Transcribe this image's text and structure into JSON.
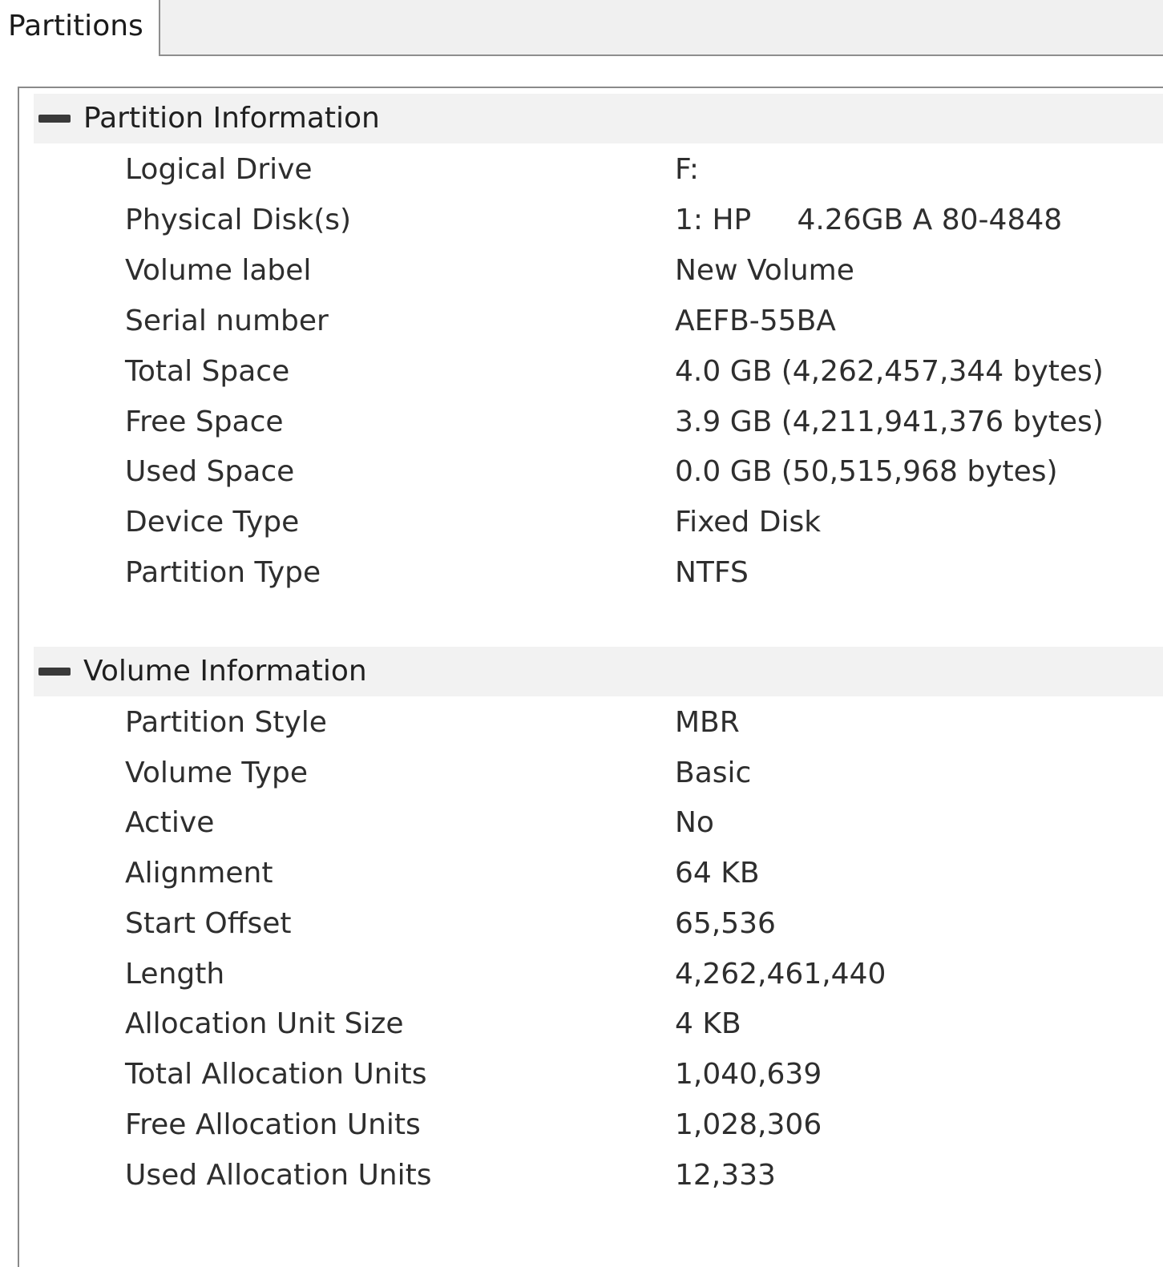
{
  "tab": {
    "label": "Partitions"
  },
  "partition_info": {
    "title": "Partition Information",
    "rows": [
      {
        "label": "Logical Drive",
        "value": "F:"
      },
      {
        "label": "Physical Disk(s)",
        "value": "1: HP     4.26GB A 80-4848"
      },
      {
        "label": "Volume label",
        "value": "New Volume"
      },
      {
        "label": "Serial number",
        "value": "AEFB-55BA"
      },
      {
        "label": "Total Space",
        "value": "4.0 GB (4,262,457,344 bytes)"
      },
      {
        "label": "Free Space",
        "value": "3.9 GB (4,211,941,376 bytes)"
      },
      {
        "label": "Used Space",
        "value": "0.0 GB (50,515,968 bytes)"
      },
      {
        "label": "Device Type",
        "value": "Fixed Disk"
      },
      {
        "label": "Partition Type",
        "value": "NTFS"
      }
    ]
  },
  "volume_info": {
    "title": "Volume Information",
    "rows": [
      {
        "label": "Partition Style",
        "value": "MBR"
      },
      {
        "label": "Volume Type",
        "value": "Basic"
      },
      {
        "label": "Active",
        "value": "No"
      },
      {
        "label": "Alignment",
        "value": "64 KB"
      },
      {
        "label": "Start Offset",
        "value": "65,536"
      },
      {
        "label": "Length",
        "value": "4,262,461,440"
      },
      {
        "label": "Allocation Unit Size",
        "value": "4 KB"
      },
      {
        "label": "Total Allocation Units",
        "value": "1,040,639"
      },
      {
        "label": "Free Allocation Units",
        "value": "1,028,306"
      },
      {
        "label": "Used Allocation Units",
        "value": "12,333"
      }
    ]
  }
}
